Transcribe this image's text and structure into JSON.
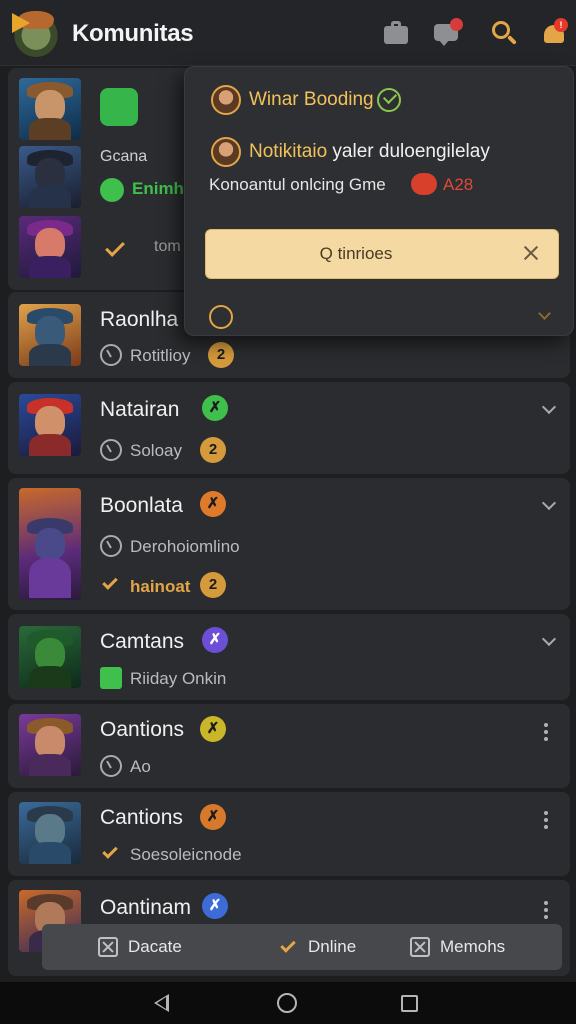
{
  "header": {
    "title": "Komunitas",
    "icons": [
      "logo-icon",
      "briefcase-icon",
      "chat-icon",
      "search-icon",
      "bell-icon"
    ],
    "bell_badge": "!"
  },
  "top_card": {
    "rows": [
      {
        "title": "",
        "subtitle": "Gcana"
      },
      {
        "title": "",
        "subtitle": "Enimh"
      },
      {
        "title": "",
        "subtitle": "tom"
      }
    ]
  },
  "popover": {
    "title": "Winar Booding",
    "notification_highlight": "Notikitaio",
    "notification_text": " yaler duloengilelay",
    "status_text": "Konoantul onlcing Gme",
    "count": "A28",
    "input_placeholder": "Q tinrioes"
  },
  "list": [
    {
      "name": "Raonlha",
      "tag": "2",
      "tag_color": "#d59a3c",
      "subtitle": "Rotitlioy",
      "subtitle2": "",
      "control": "chevron"
    },
    {
      "name": "Natairan",
      "tag": "✗",
      "tag_color": "#3fbf4c",
      "subtitle": "Soloay",
      "tag2": "2",
      "control": "chevron"
    },
    {
      "name": "Boonlata",
      "tag": "✗",
      "tag_color": "#e07a2b",
      "subtitle": "Derohoiomlino",
      "subtitle2": "hainoat",
      "tag2": "2",
      "control": "chevron"
    },
    {
      "name": "Camtans",
      "tag": "✗",
      "tag_color": "#6b4fd6",
      "subtitle": "Riiday Onkin",
      "control": "chevron"
    },
    {
      "name": "Oantions",
      "tag": "✗",
      "tag_color": "#c9b629",
      "subtitle": "Ao",
      "control": "more"
    },
    {
      "name": "Cantions",
      "tag": "✗",
      "tag_color": "#d6792a",
      "subtitle": "Soesoleicnode",
      "control": "more"
    },
    {
      "name": "Oantinam",
      "tag": "✗",
      "tag_color": "#3d6bd8",
      "subtitle": "",
      "control": "more"
    }
  ],
  "actions": [
    {
      "label": "Dacate",
      "icon": "close-box-icon"
    },
    {
      "label": "Dnline",
      "icon": "check-icon"
    },
    {
      "label": "Memohs",
      "icon": "close-box-icon"
    }
  ],
  "colors": {
    "background": "#1d1e20",
    "card": "#2b2c2f",
    "accent_gold": "#e3a547",
    "popover_title": "#f2c25a",
    "input_bg": "#f4d9a2"
  }
}
